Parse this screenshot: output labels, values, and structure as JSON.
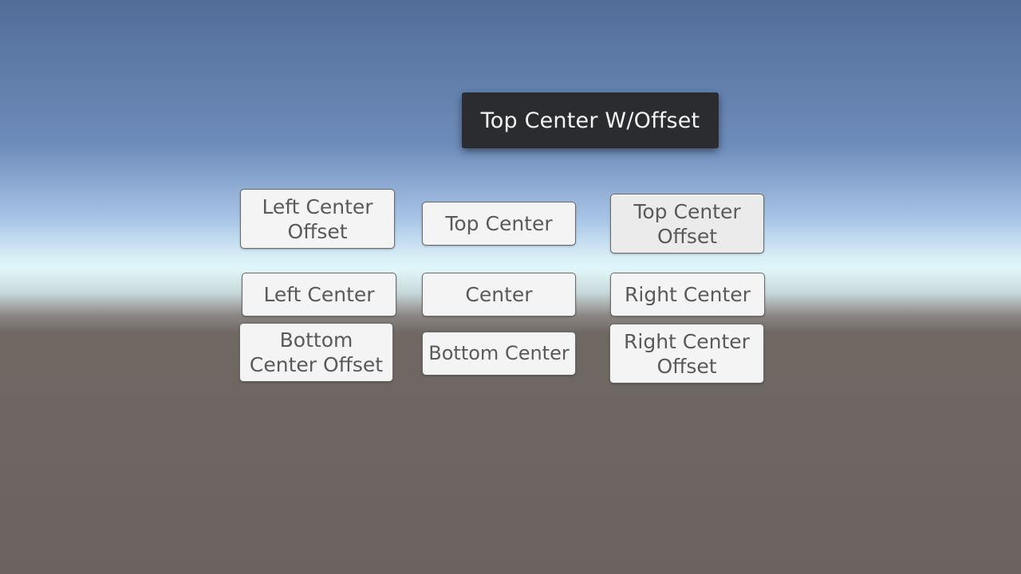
{
  "tooltip": {
    "text": "Top Center W/Offset"
  },
  "buttons": {
    "left_center_offset": "Left Center Offset",
    "top_center": "Top Center",
    "top_center_offset": "Top Center Offset",
    "left_center": "Left Center",
    "center": "Center",
    "right_center": "Right Center",
    "bottom_center_offset": "Bottom Center Offset",
    "bottom_center": "Bottom Center",
    "right_center_offset": "Right Center Offset"
  }
}
